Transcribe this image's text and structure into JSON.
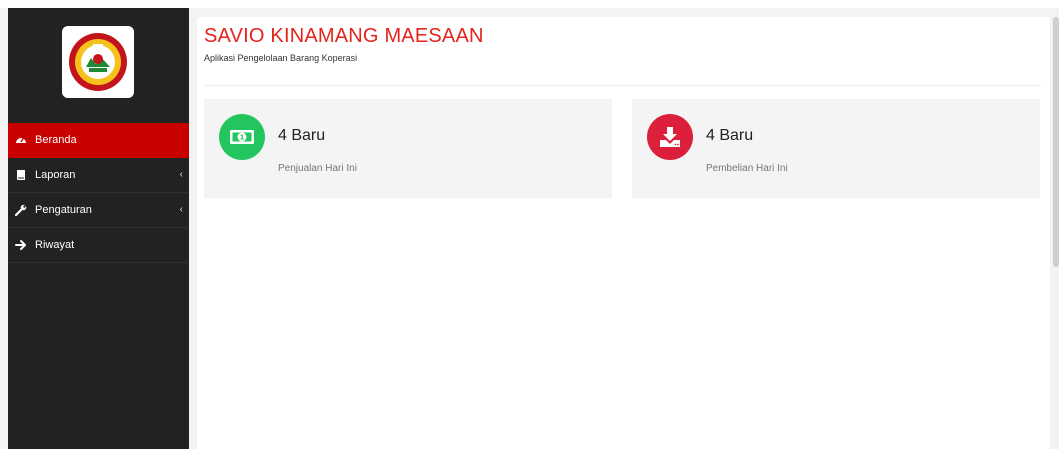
{
  "brand": {
    "logo_icon": "cooperative-seal-logo"
  },
  "sidebar": {
    "items": [
      {
        "label": "Beranda",
        "icon": "dashboard-icon",
        "active": true,
        "chevron": false
      },
      {
        "label": "Laporan",
        "icon": "book-icon",
        "active": false,
        "chevron": true
      },
      {
        "label": "Pengaturan",
        "icon": "wrench-icon",
        "active": false,
        "chevron": true
      },
      {
        "label": "Riwayat",
        "icon": "arrow-right-icon",
        "active": false,
        "chevron": false
      }
    ],
    "chevron_glyph": "‹"
  },
  "header": {
    "title": "SAVIO KINAMANG MAESAAN",
    "subtitle": "Aplikasi Pengelolaan Barang Koperasi"
  },
  "cards": [
    {
      "value": "4 Baru",
      "label": "Penjualan Hari Ini",
      "icon": "money-icon",
      "color": "#22c55e"
    },
    {
      "value": "4 Baru",
      "label": "Pembelian Hari Ini",
      "icon": "download-icon",
      "color": "#dc1f3a"
    }
  ],
  "colors": {
    "accent": "#e4231c",
    "sidebar_bg": "#222222",
    "active_item": "#c80000"
  }
}
